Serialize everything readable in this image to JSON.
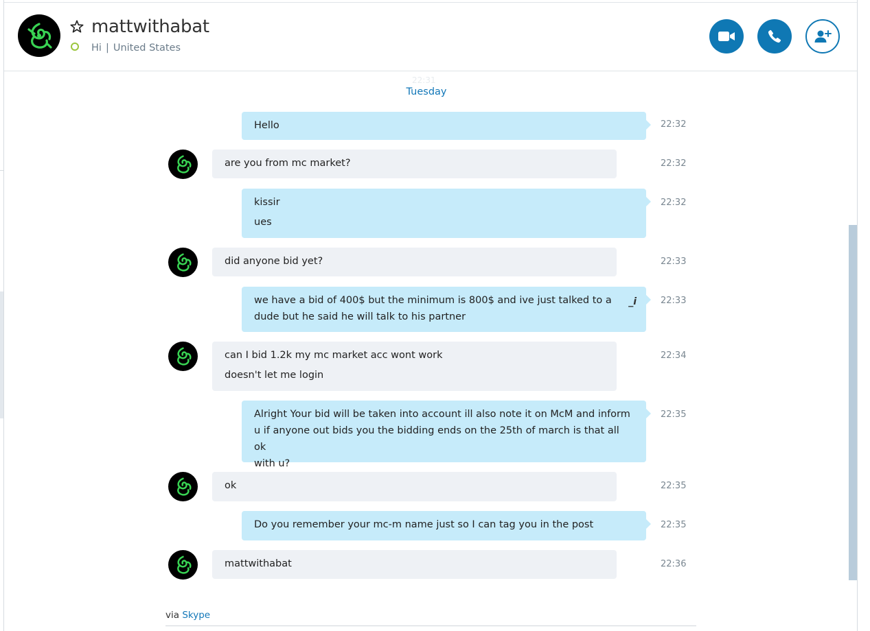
{
  "contact": {
    "name": "mattwithabat",
    "mood": "Hi",
    "separator": "|",
    "location": "United States"
  },
  "header_buttons": {
    "video_icon": "video-camera-icon",
    "call_icon": "phone-icon",
    "add_icon": "add-contact-icon"
  },
  "colors": {
    "accent": "#0f78b4",
    "outgoing_bubble": "#c6ebfa",
    "incoming_bubble": "#eef1f5",
    "presence": "#9bc53d",
    "avatar_green": "#39d353"
  },
  "conversation": {
    "ghost_time": "22:31",
    "day": "Tuesday",
    "messages": [
      {
        "from": "me",
        "lines": [
          "Hello"
        ],
        "time": "22:32"
      },
      {
        "from": "contact",
        "lines": [
          "are you from mc market?"
        ],
        "time": "22:32"
      },
      {
        "from": "me",
        "lines": [
          "kissir",
          "ues"
        ],
        "time": "22:32"
      },
      {
        "from": "contact",
        "lines": [
          "did anyone bid yet?"
        ],
        "time": "22:33"
      },
      {
        "from": "me",
        "lines": [
          "we have a bid of 400$ but the minimum is 800$ and ive just talked to a",
          "dude but he said he will talk to his partner"
        ],
        "time": "22:33",
        "edited_icon": "_i"
      },
      {
        "from": "contact",
        "lines": [
          "can I bid 1.2k my mc market acc wont work",
          "doesn't let me login"
        ],
        "time": "22:34"
      },
      {
        "from": "me",
        "lines": [
          "Alright Your bid will be taken into account ill also note it on McM and inform",
          "u if anyone out bids you the bidding ends on the 25th of march is that all ok",
          "with u?"
        ],
        "time": "22:35"
      },
      {
        "from": "contact",
        "lines": [
          "ok"
        ],
        "time": "22:35"
      },
      {
        "from": "me",
        "lines": [
          "Do you remember your mc-m name just so I can tag you in the post"
        ],
        "time": "22:35"
      },
      {
        "from": "contact",
        "lines": [
          "mattwithabat"
        ],
        "time": "22:36"
      }
    ]
  },
  "footer": {
    "via_prefix": "via",
    "via_link": "Skype"
  }
}
